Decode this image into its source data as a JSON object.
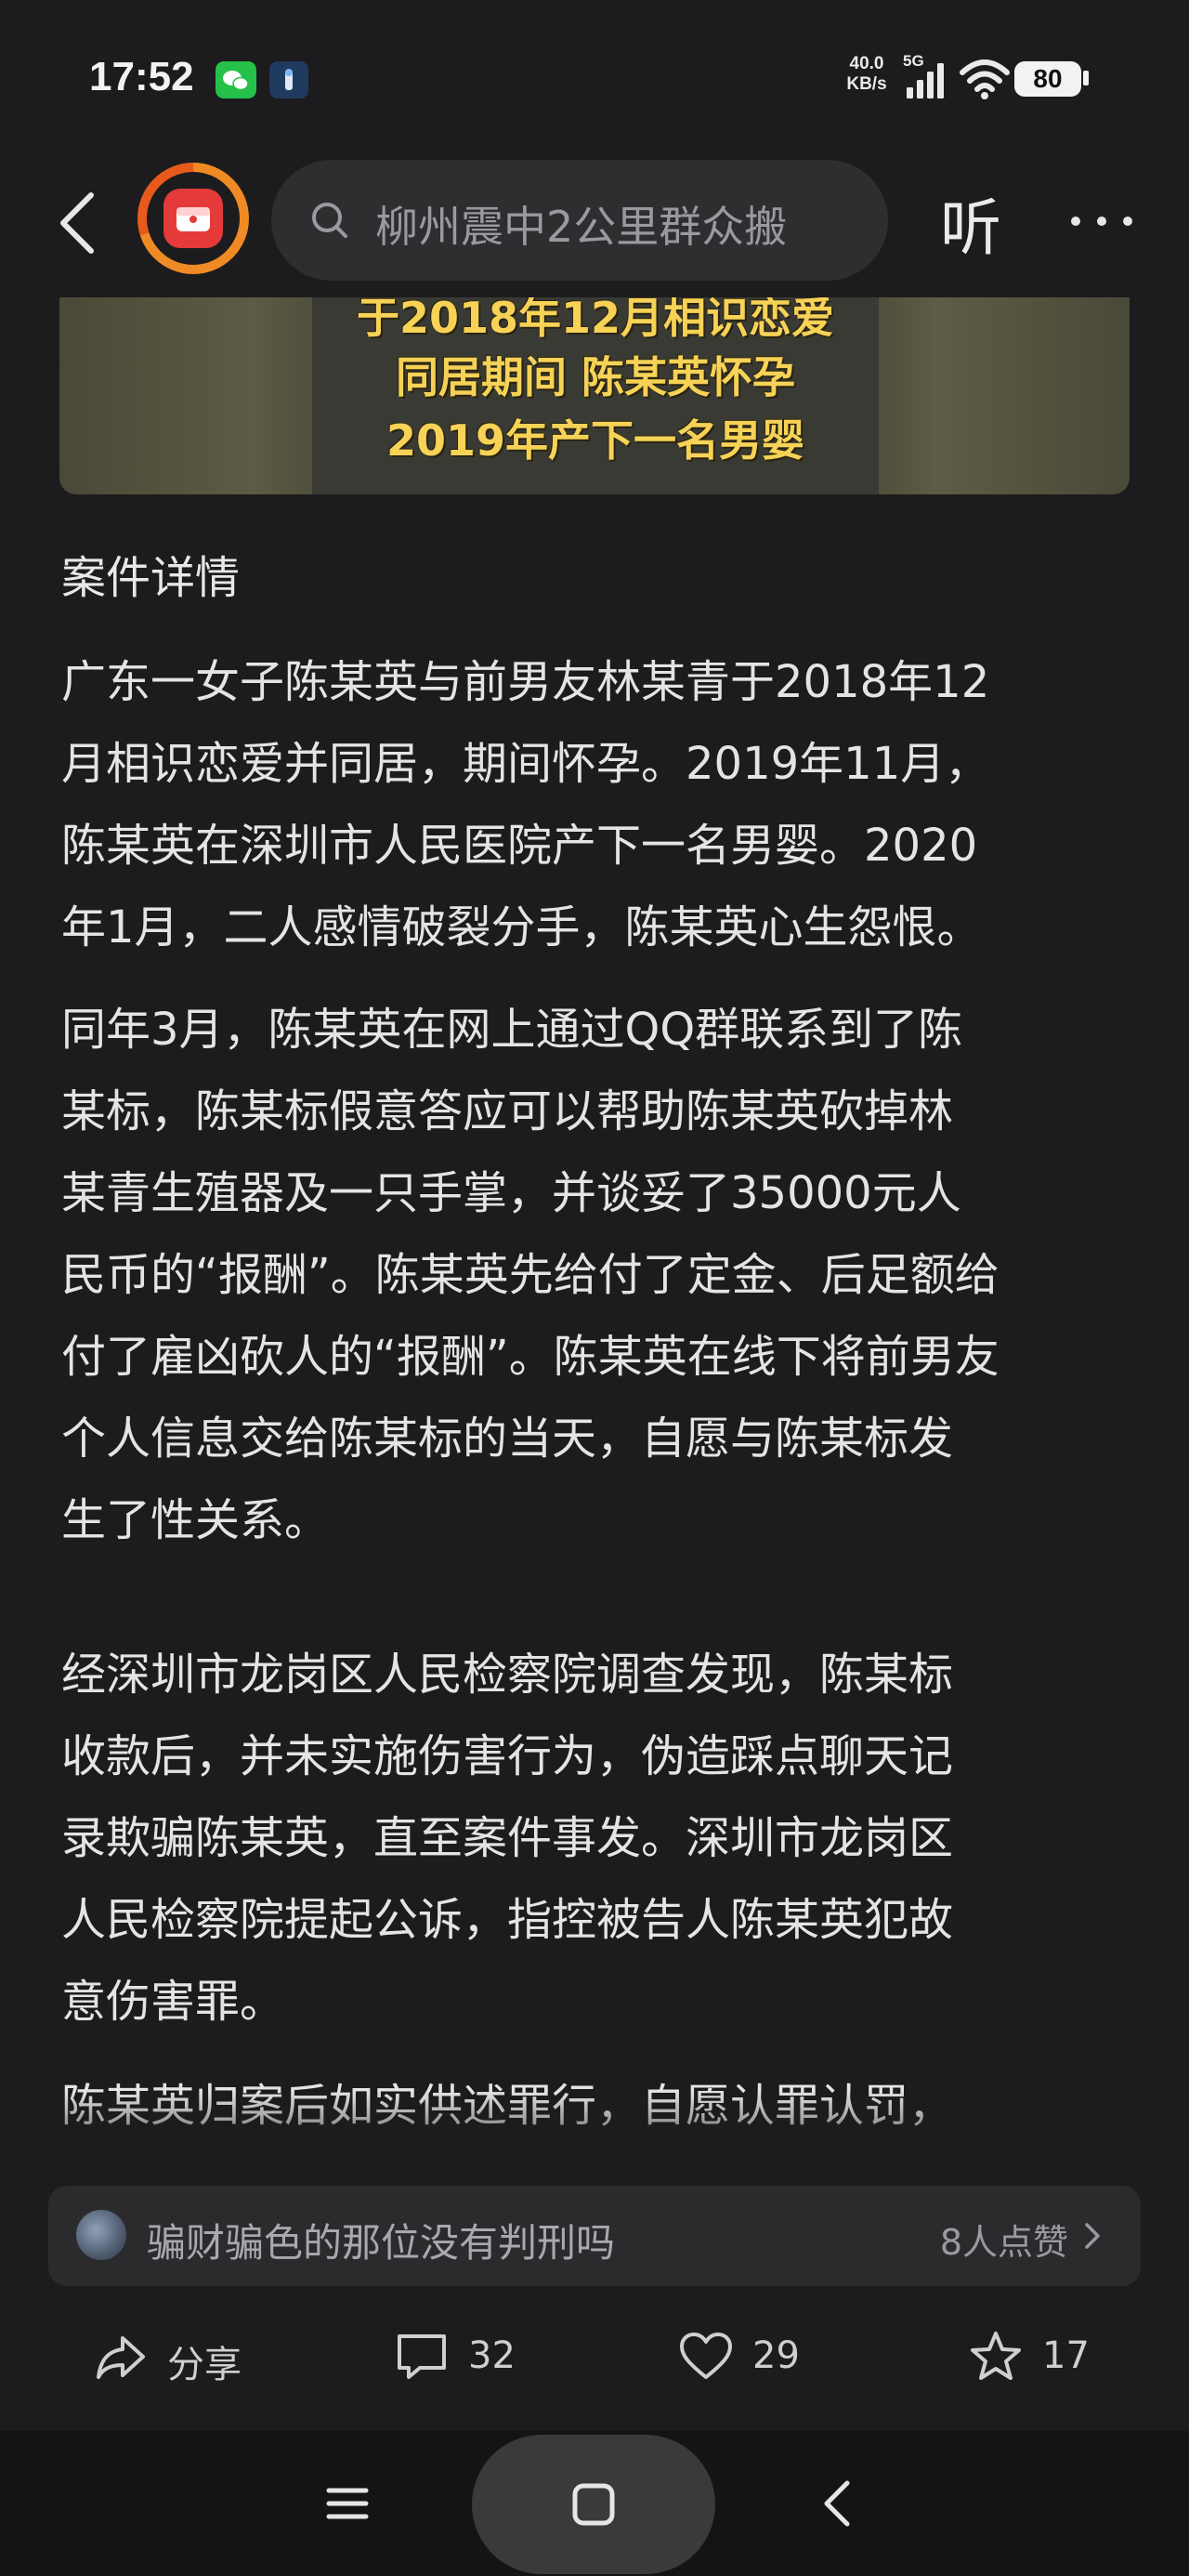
{
  "status_bar": {
    "time": "17:52",
    "net_speed_value": "40.0",
    "net_speed_unit": "KB/s",
    "network_type": "5G",
    "battery": "80"
  },
  "nav": {
    "search_text": "柳州震中2公里群众搬",
    "listen_label": "听"
  },
  "hero": {
    "lines": [
      "于2018年12月相识恋爱",
      "同居期间 陈某英怀孕",
      "2019年产下一名男婴"
    ]
  },
  "article": {
    "section_title": "案件详情",
    "paragraphs": [
      [
        "广东一女子陈某英与前男友林某青于2018年12",
        "月相识恋爱并同居，期间怀孕。2019年11月，",
        "陈某英在深圳市人民医院产下一名男婴。2020",
        "年1月，二人感情破裂分手，陈某英心生怨恨。"
      ],
      [
        "同年3月，陈某英在网上通过QQ群联系到了陈",
        "某标，陈某标假意答应可以帮助陈某英砍掉林",
        "某青生殖器及一只手掌，并谈妥了35000元人",
        "民币的“报酬”。陈某英先给付了定金、后足额给",
        "付了雇凶砍人的“报酬”。陈某英在线下将前男友",
        "个人信息交给陈某标的当天，自愿与陈某标发",
        "生了性关系。"
      ],
      [
        "经深圳市龙岗区人民检察院调查发现，陈某标",
        "收款后，并未实施伤害行为，伪造踩点聊天记",
        "录欺骗陈某英，直至案件事发。深圳市龙岗区",
        "人民检察院提起公诉，指控被告人陈某英犯故",
        "意伤害罪。"
      ],
      [
        "陈某英归案后如实供述罪行，自愿认罪认罚，"
      ]
    ]
  },
  "top_comment": {
    "text": "骗财骗色的那位没有判刑吗",
    "likes": "8人点赞"
  },
  "actions": {
    "share": "分享",
    "comments": "32",
    "likes": "29",
    "favorites": "17"
  }
}
